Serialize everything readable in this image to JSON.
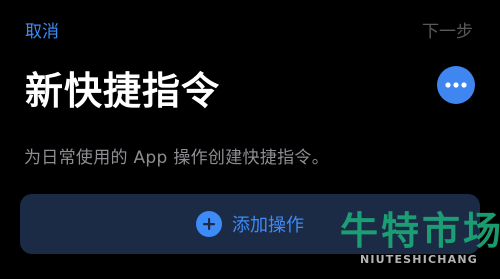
{
  "header": {
    "cancel_label": "取消",
    "next_label": "下一步",
    "title": "新快捷指令",
    "more_icon": "ellipsis-icon"
  },
  "main": {
    "description": "为日常使用的 App 操作创建快捷指令。",
    "add_action_label": "添加操作",
    "add_action_icon": "plus-circle-icon"
  },
  "watermark": {
    "name": "牛特市场",
    "subtitle": "NIUTESHICHANG"
  },
  "colors": {
    "background": "#000000",
    "accent": "#3d8bf7",
    "disabled": "#5a5a5e",
    "secondary_text": "#8d8d93",
    "card_background": "#1c2b45",
    "watermark_green": "#1ca878"
  }
}
